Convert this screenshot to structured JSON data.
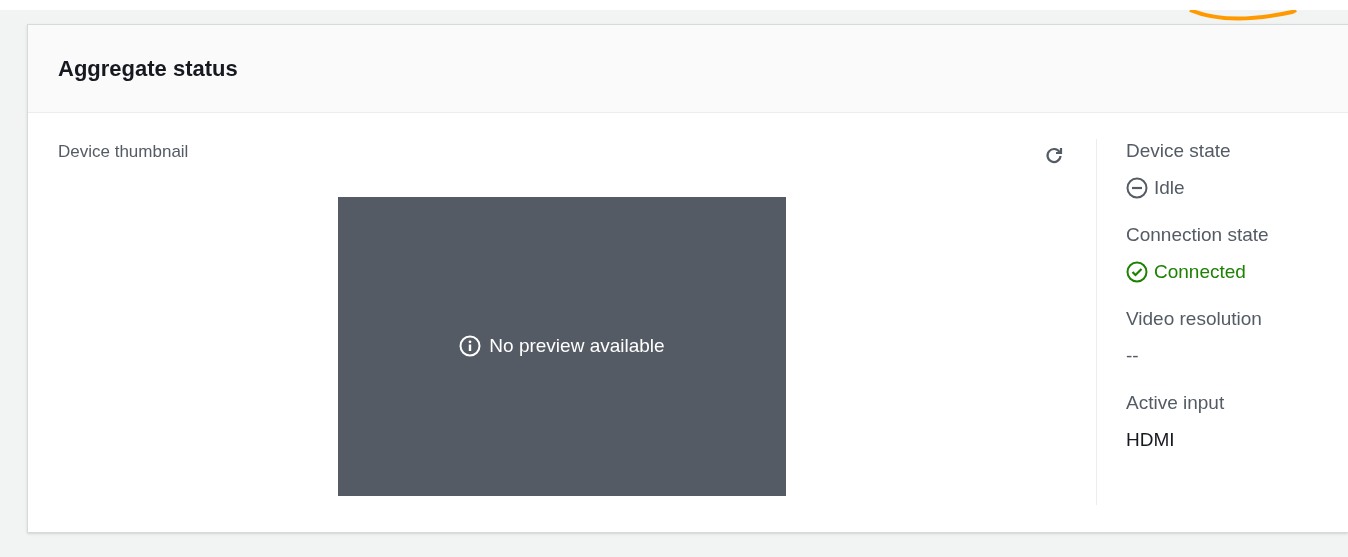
{
  "panel": {
    "title": "Aggregate status"
  },
  "thumbnail": {
    "label": "Device thumbnail",
    "message": "No preview available"
  },
  "fields": [
    {
      "label": "Device state",
      "value": "Idle",
      "kind": "stopped"
    },
    {
      "label": "Connection state",
      "value": "Connected",
      "kind": "success"
    },
    {
      "label": "Video resolution",
      "value": "--",
      "kind": "empty"
    },
    {
      "label": "Active input",
      "value": "HDMI",
      "kind": "text"
    }
  ]
}
